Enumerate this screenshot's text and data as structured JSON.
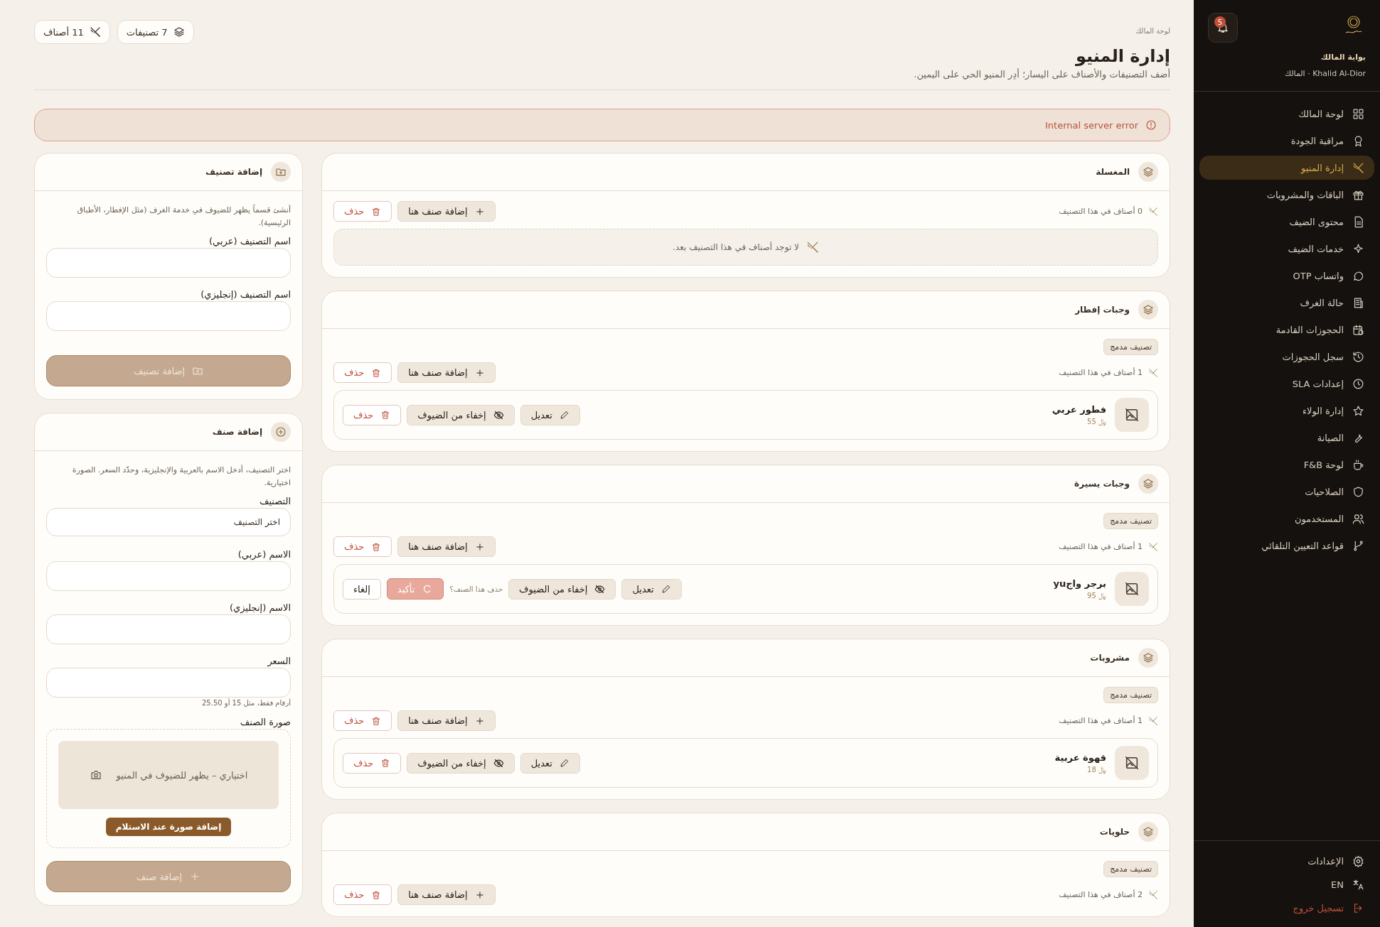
{
  "sidebar": {
    "brand": "بوابة المالك",
    "user": "Khalid Al-Dior · المالك",
    "notification_count": "5",
    "items": [
      {
        "label": "لوحة المالك",
        "selected": false
      },
      {
        "label": "مراقبة الجودة",
        "selected": false
      },
      {
        "label": "إدارة المنيو",
        "selected": true
      },
      {
        "label": "الباقات والمشروبات",
        "selected": false
      },
      {
        "label": "محتوى الضيف",
        "selected": false
      },
      {
        "label": "خدمات الضيف",
        "selected": false
      },
      {
        "label": "واتساب OTP",
        "selected": false
      },
      {
        "label": "حالة الغرف",
        "selected": false
      },
      {
        "label": "الحجوزات القادمة",
        "selected": false
      },
      {
        "label": "سجل الحجوزات",
        "selected": false
      },
      {
        "label": "إعدادات SLA",
        "selected": false
      },
      {
        "label": "إدارة الولاء",
        "selected": false
      },
      {
        "label": "الصيانة",
        "selected": false
      },
      {
        "label": "لوحة F&B",
        "selected": false
      },
      {
        "label": "الصلاحيات",
        "selected": false
      },
      {
        "label": "المستخدمون",
        "selected": false
      },
      {
        "label": "قواعد التعيين التلقائي",
        "selected": false
      }
    ],
    "footer": [
      {
        "kind": "settings",
        "label": "الإعدادات"
      },
      {
        "kind": "language",
        "label": "EN"
      },
      {
        "kind": "logout",
        "label": "تسجيل خروج"
      }
    ]
  },
  "header": {
    "breadcrumb": "لوحة المالك",
    "title": "إدارة المنيو",
    "subtitle": "أضف التصنيفات والأصناف على اليسار؛ أدِر المنيو الحي على اليمين.",
    "stats": [
      {
        "kind": "categories",
        "label": "7 تصنيفات"
      },
      {
        "kind": "items",
        "label": "11 أصناف"
      }
    ]
  },
  "alert": {
    "message": "Internal server error"
  },
  "categories": [
    {
      "title": "المغسلة",
      "merged": false,
      "count": "0 أصناف في هذا التصنيف",
      "add_label": "إضافة صنف هنا",
      "delete_label": "حذف",
      "empty_text": "لا توجد أصناف في هذا التصنيف بعد."
    },
    {
      "title": "وجبات إفطار",
      "merged": true,
      "badge": "تصنيف مدمج",
      "count": "1 أصناف في هذا التصنيف",
      "add_label": "إضافة صنف هنا",
      "delete_label": "حذف",
      "items": [
        {
          "name": "فطور عربي",
          "price": "﷼ 55",
          "edit_label": "تعديل",
          "hide_label": "إخفاء من الضيوف",
          "confirming": false,
          "delete_label": "حذف"
        }
      ]
    },
    {
      "title": "وجبات يسيرة",
      "merged": true,
      "badge": "تصنيف مدمج",
      "count": "1 أصناف في هذا التصنيف",
      "add_label": "إضافة صنف هنا",
      "delete_label": "حذف",
      "items": [
        {
          "name": "برجر واجyu",
          "price": "﷼ 95",
          "edit_label": "تعديل",
          "hide_label": "إخفاء من الضيوف",
          "confirming": true,
          "question": "حذف هذا الصنف؟",
          "confirm_label": "تأكيد",
          "cancel_label": "إلغاء"
        }
      ]
    },
    {
      "title": "مشروبات",
      "merged": true,
      "badge": "تصنيف مدمج",
      "count": "1 أصناف في هذا التصنيف",
      "add_label": "إضافة صنف هنا",
      "delete_label": "حذف",
      "items": [
        {
          "name": "قهوة عربية",
          "price": "﷼ 18",
          "edit_label": "تعديل",
          "hide_label": "إخفاء من الضيوف",
          "confirming": false,
          "delete_label": "حذف"
        }
      ]
    },
    {
      "title": "حلويات",
      "merged": true,
      "badge": "تصنيف مدمج",
      "count": "2 أصناف في هذا التصنيف",
      "add_label": "إضافة صنف هنا",
      "delete_label": "حذف"
    }
  ],
  "category_form": {
    "title": "إضافة تصنيف",
    "description": "أنشئ قسماً يظهر للضيوف في خدمة الغرف (مثل الإفطار، الأطباق الرئيسية).",
    "fields": [
      {
        "kind": "text",
        "label": "اسم التصنيف (عربي)"
      },
      {
        "kind": "text",
        "label": "اسم التصنيف (إنجليزي)"
      }
    ],
    "submit": {
      "label": "إضافة تصنيف",
      "disabled": true
    }
  },
  "item_form": {
    "title": "إضافة صنف",
    "description": "اختر التصنيف، أدخل الاسم بالعربية والإنجليزية، وحدّد السعر. الصورة اختيارية.",
    "fields": [
      {
        "kind": "select",
        "label": "التصنيف",
        "placeholder": "اختر التصنيف"
      },
      {
        "kind": "text",
        "label": "الاسم (عربي)"
      },
      {
        "kind": "text",
        "label": "الاسم (إنجليزي)"
      },
      {
        "kind": "text",
        "label": "السعر",
        "hint": "أرقام فقط، مثل 15 أو 25.50"
      }
    ],
    "image": {
      "label": "صورة الصنف",
      "placeholder": "اختياري – يظهر للضيوف في المنيو",
      "button": "إضافة صورة عند الاستلام"
    },
    "submit": {
      "label": "إضافة صنف",
      "disabled": true
    }
  }
}
